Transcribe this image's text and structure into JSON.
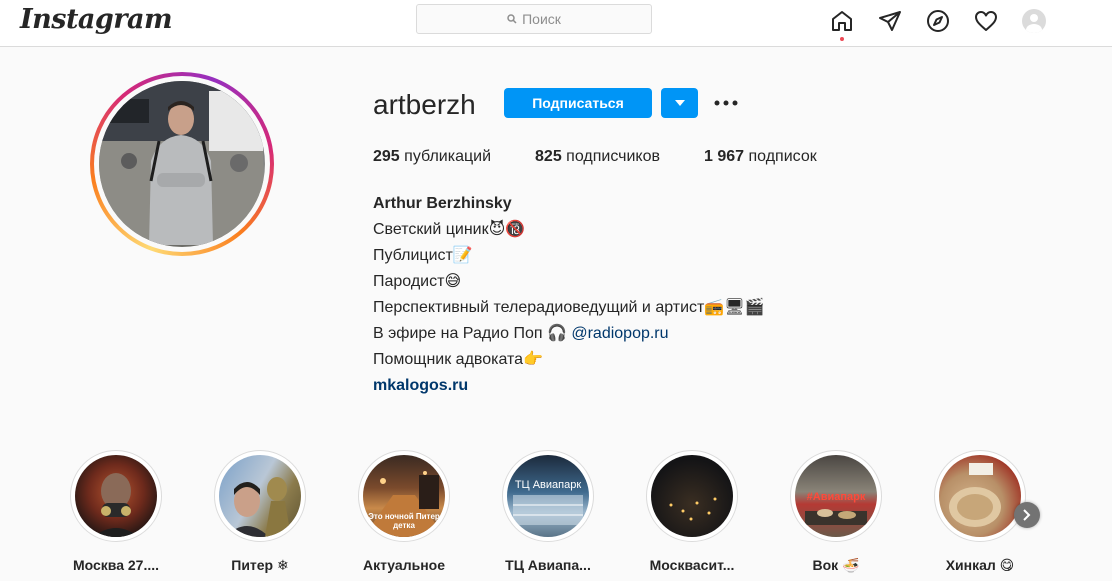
{
  "header": {
    "logo": "Instagram",
    "search_placeholder": "Поиск"
  },
  "nav": {
    "icons": [
      "home-icon",
      "direct-icon",
      "explore-icon",
      "activity-heart-icon",
      "profile-avatar"
    ]
  },
  "profile": {
    "username": "artberzh",
    "follow_label": "Подписаться",
    "stats": {
      "posts_count": "295",
      "posts_label": "публикаций",
      "followers_count": "825",
      "followers_label": "подписчиков",
      "following_count": "1 967",
      "following_label": "подписок"
    },
    "bio": {
      "name": "Arthur Berzhinsky",
      "line1": "Светский циник😈🔞",
      "line2": "Публицист📝",
      "line3": "Пародист😅",
      "line4": "Перспективный телерадиоведущий и артист📻🖥🎬",
      "line5_prefix": "В эфире на Радио Поп 🎧 ",
      "line5_mention": "@radiopop.ru",
      "line6": "Помощник адвоката👉",
      "website": "mkalogos.ru"
    }
  },
  "highlights": [
    {
      "label": "Москва 27....",
      "caption": ""
    },
    {
      "label": "Питер ❄",
      "caption": ""
    },
    {
      "label": "Актуальное",
      "caption": "Это ночной Питер детка"
    },
    {
      "label": "ТЦ Авиапа...",
      "caption": "ТЦ Авиапарк"
    },
    {
      "label": "Москвасит...",
      "caption": ""
    },
    {
      "label": "Вок 🍜",
      "caption": "#Авиапарк"
    },
    {
      "label": "Хинкал 😋",
      "caption": ""
    }
  ],
  "colors": {
    "accent": "#0095f6",
    "link": "#00376b",
    "notification_dot": "#ed4956"
  }
}
